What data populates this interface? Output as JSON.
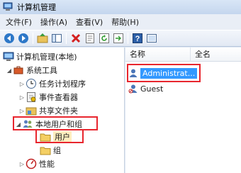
{
  "window": {
    "title": "计算机管理"
  },
  "menu": [
    "文件(F)",
    "操作(A)",
    "查看(V)",
    "帮助(H)"
  ],
  "toolbar": [
    "back-icon",
    "forward-icon",
    "up-folder-icon",
    "show-hide-tree-icon",
    "delete-icon",
    "properties-icon",
    "refresh-icon",
    "export-icon",
    "help-icon",
    "console-icon"
  ],
  "tree": {
    "root": "计算机管理(本地)",
    "system_tools": "系统工具",
    "task_scheduler": "任务计划程序",
    "event_viewer": "事件查看器",
    "shared_folders": "共享文件夹",
    "local_users_groups": "本地用户和组",
    "users": "用户",
    "groups": "组",
    "performance": "性能"
  },
  "list": {
    "columns": {
      "name": "名称",
      "fullname": "全名"
    },
    "rows": [
      {
        "name": "Administrat...",
        "selected": true
      },
      {
        "name": "Guest",
        "selected": false
      }
    ]
  },
  "colors": {
    "highlight": "#e8262e",
    "selection": "#3399ff"
  }
}
